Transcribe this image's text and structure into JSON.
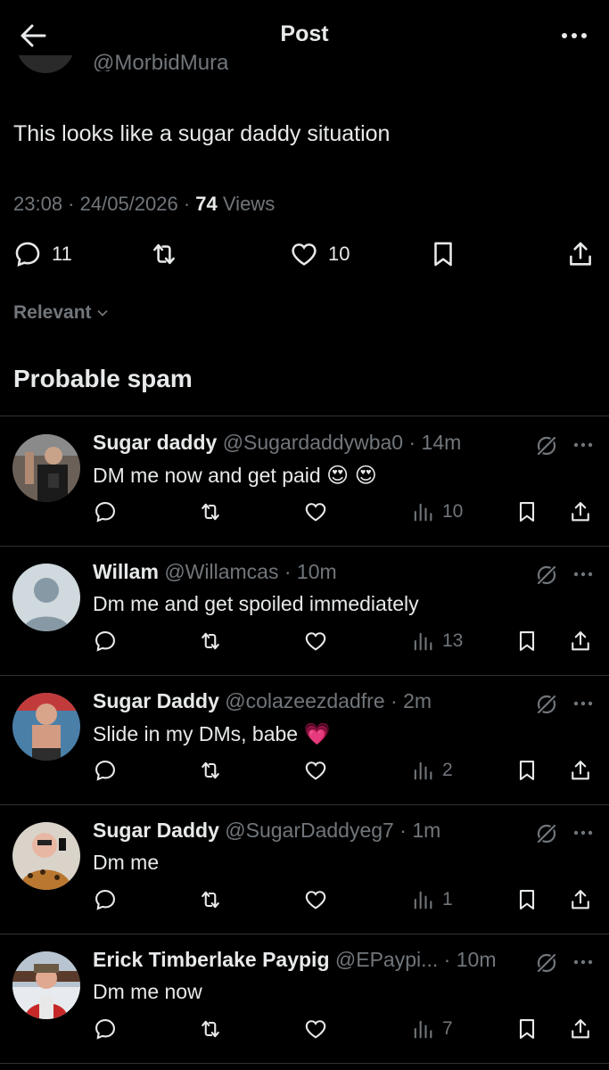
{
  "header": {
    "title": "Post"
  },
  "parent_author": {
    "handle_clipped": "@MorbidMura"
  },
  "post": {
    "text": "This looks like a sugar daddy situation",
    "time": "23:08",
    "date": "24/05/2026",
    "views_count": "74",
    "views_label": "Views",
    "replies": "11",
    "likes": "10"
  },
  "sort": {
    "label": "Relevant"
  },
  "section": {
    "title": "Probable spam"
  },
  "replies": [
    {
      "name": "Sugar daddy",
      "handle": "@Sugardaddywba0",
      "time": "14m",
      "text": "DM me now and get paid",
      "emoji": "😍 😍",
      "views": "10"
    },
    {
      "name": "Willam",
      "handle": "@Willamcas",
      "time": "10m",
      "text": "Dm me and get spoiled immediately",
      "emoji": "",
      "views": "13"
    },
    {
      "name": "Sugar Daddy",
      "handle": "@colazeezdadfre",
      "time": "2m",
      "text": "Slide in my DMs, babe",
      "emoji": "💗",
      "views": "2"
    },
    {
      "name": "Sugar Daddy",
      "handle": "@SugarDaddyeg7",
      "time": "1m",
      "text": "Dm me",
      "emoji": "",
      "views": "1"
    },
    {
      "name": "Erick Timberlake Paypig",
      "handle": "@EPaypi...",
      "time": "10m",
      "text": "Dm me now",
      "emoji": "",
      "views": "7"
    }
  ],
  "icons": {
    "back": "arrow-left-icon",
    "more": "more-horizontal-icon",
    "reply": "reply-bubble-icon",
    "repost": "repost-icon",
    "like": "heart-icon",
    "bookmark": "bookmark-icon",
    "share": "share-icon",
    "views": "views-bar-chart-icon",
    "grok": "grok-icon"
  },
  "colors": {
    "background": "#000000",
    "text": "#e7e9ea",
    "muted": "#71767b",
    "divider": "#2f3336"
  }
}
